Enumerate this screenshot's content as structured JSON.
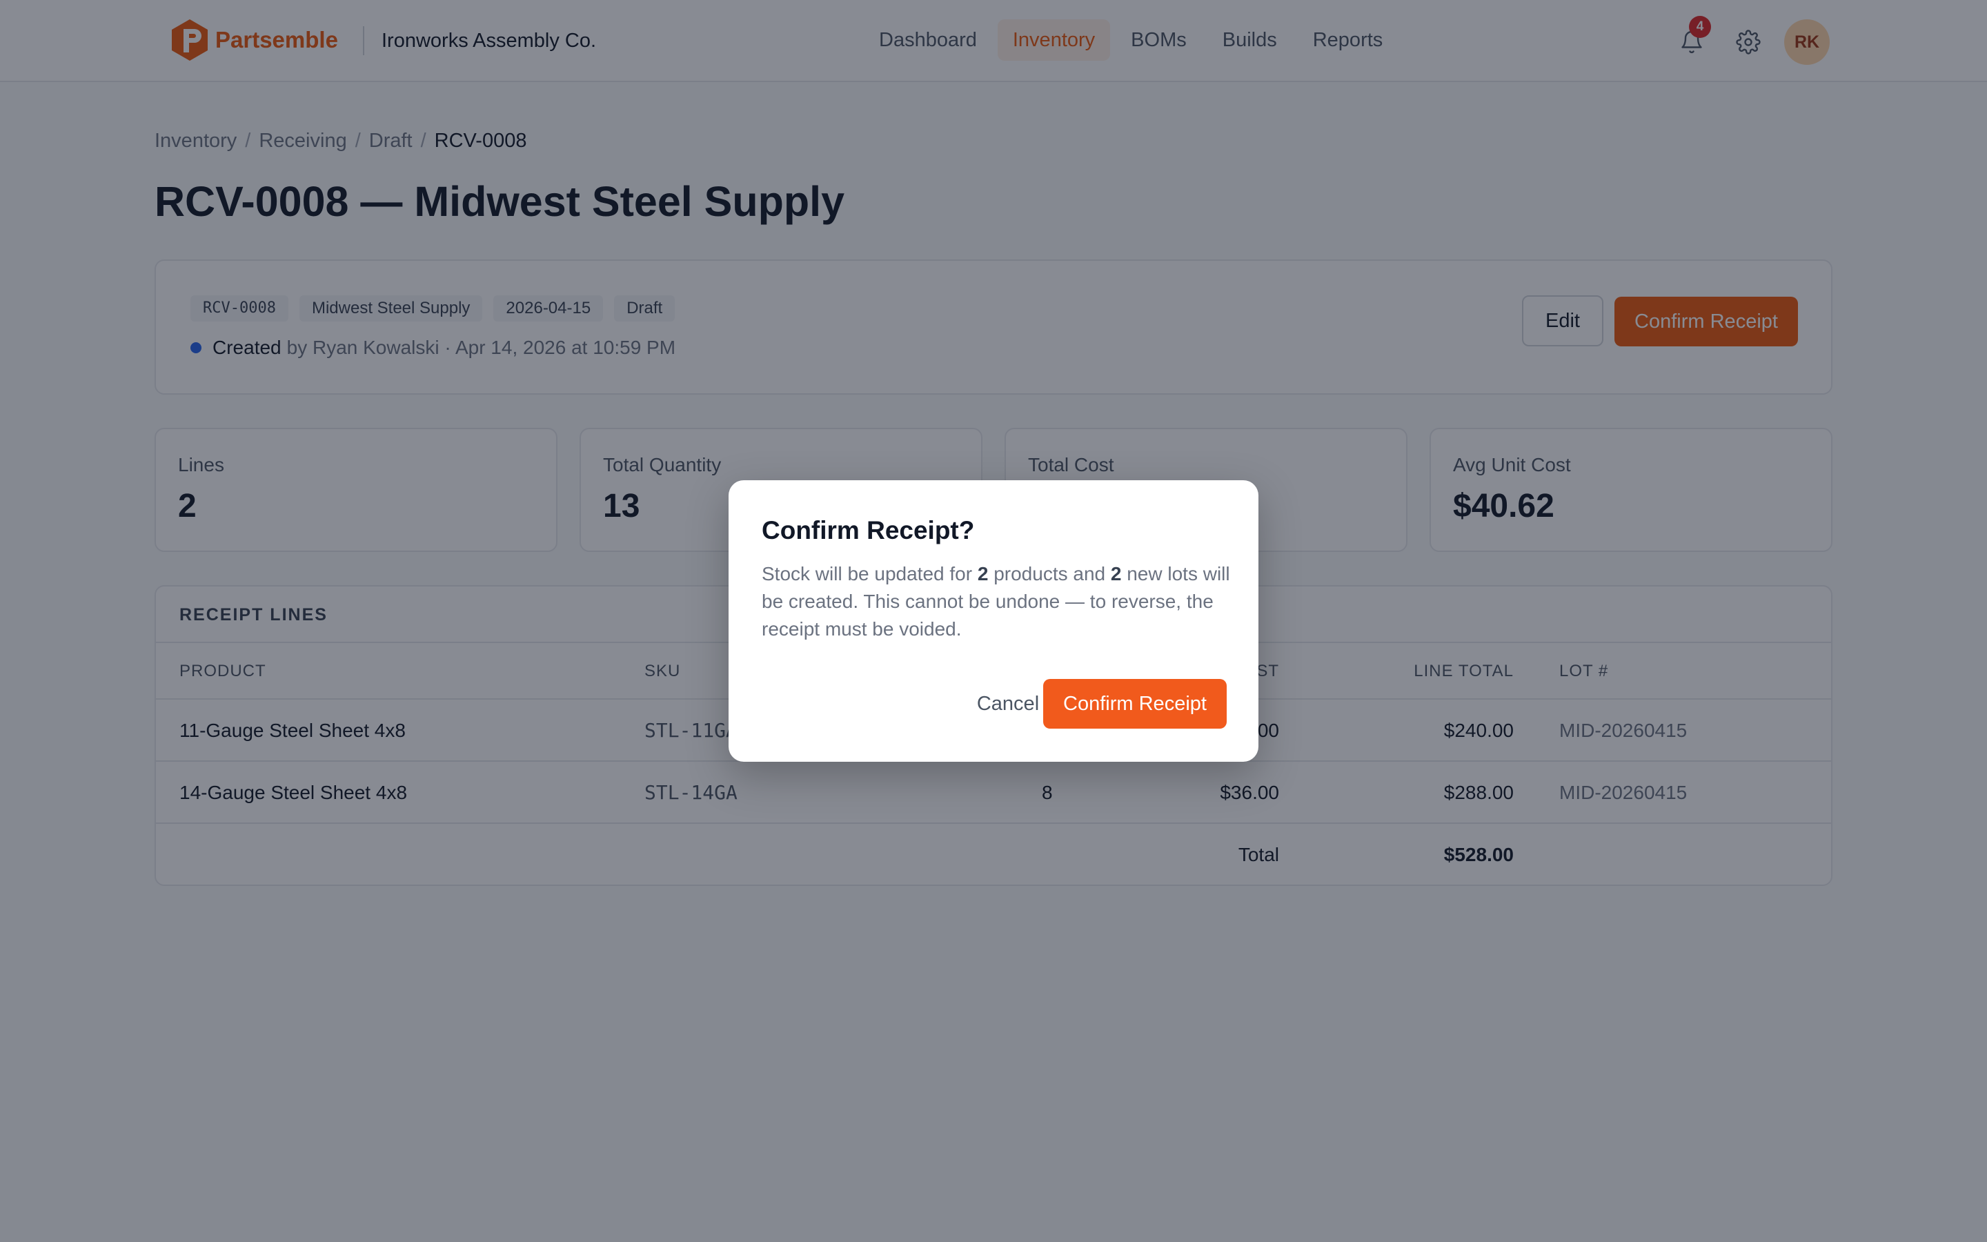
{
  "header": {
    "brand": "Partsemble",
    "org": "Ironworks Assembly Co.",
    "nav": [
      {
        "label": "Dashboard",
        "active": false
      },
      {
        "label": "Inventory",
        "active": true
      },
      {
        "label": "BOMs",
        "active": false
      },
      {
        "label": "Builds",
        "active": false
      },
      {
        "label": "Reports",
        "active": false
      }
    ],
    "notifications_count": "4",
    "avatar_initials": "RK",
    "accent_color": "#ea580c"
  },
  "breadcrumb": [
    "Inventory",
    "Receiving",
    "Draft",
    "RCV-0008"
  ],
  "page_title": "RCV-0008 — Midwest Steel Supply",
  "summary": {
    "tags": [
      "RCV-0008",
      "Midwest Steel Supply",
      "2026-04-15",
      "Draft"
    ],
    "status_word": "Created",
    "created_meta": "by Ryan Kowalski · Apr 14, 2026 at 10:59 PM",
    "edit_label": "Edit",
    "confirm_label": "Confirm Receipt"
  },
  "stats": [
    {
      "label": "Lines",
      "value": "2"
    },
    {
      "label": "Total Quantity",
      "value": "13"
    },
    {
      "label": "Total Cost",
      "value": ""
    },
    {
      "label": "Avg Unit Cost",
      "value": "$40.62"
    }
  ],
  "receipt_lines": {
    "title": "RECEIPT LINES",
    "columns": [
      "PRODUCT",
      "SKU",
      "",
      "ST",
      "LINE TOTAL",
      "LOT #"
    ],
    "rows": [
      {
        "product": "11-Gauge Steel Sheet 4x8",
        "sku": "STL-11GA",
        "qty": "",
        "unit_cost": ".00",
        "line_total": "$240.00",
        "lot": "MID-20260415"
      },
      {
        "product": "14-Gauge Steel Sheet 4x8",
        "sku": "STL-14GA",
        "qty": "8",
        "unit_cost": "$36.00",
        "line_total": "$288.00",
        "lot": "MID-20260415"
      }
    ],
    "total_label": "Total",
    "total_value": "$528.00"
  },
  "modal": {
    "title": "Confirm Receipt?",
    "body_pre": "Stock will be updated for ",
    "products_count": "2",
    "body_mid": " products and ",
    "lots_count": "2",
    "body_post": " new lots will be created. This cannot be undone — to reverse, the receipt must be voided.",
    "cancel_label": "Cancel",
    "confirm_label": "Confirm Receipt"
  }
}
